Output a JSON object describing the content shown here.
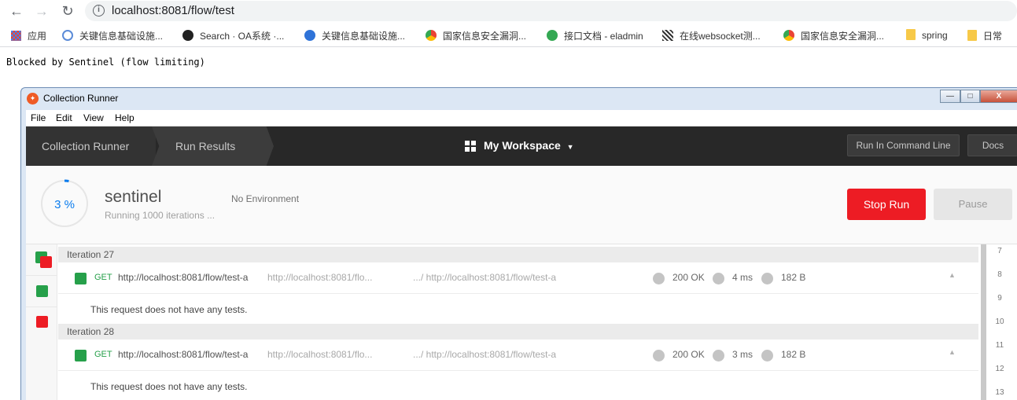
{
  "browser": {
    "url": "localhost:8081/flow/test",
    "bookmarks": [
      {
        "label": "应用",
        "color": "#4285f4"
      },
      {
        "label": "关键信息基础设施...",
        "color": "#5b8bd8"
      },
      {
        "label": "Search · OA系统 ·...",
        "color": "#222222"
      },
      {
        "label": "关键信息基础设施...",
        "color": "#2f73d8"
      },
      {
        "label": "国家信息安全漏洞...",
        "color": "#e8a33a"
      },
      {
        "label": "接口文档 - eladmin",
        "color": "#34a853"
      },
      {
        "label": "在线websocket测...",
        "color": "#555555"
      },
      {
        "label": "国家信息安全漏洞...",
        "color": "#e8a33a"
      },
      {
        "label": "spring",
        "color": "#f7c948"
      },
      {
        "label": "日常",
        "color": "#f7c948"
      }
    ]
  },
  "page": {
    "message": "Blocked by Sentinel (flow limiting)"
  },
  "window": {
    "title": "Collection Runner",
    "menu": [
      "File",
      "Edit",
      "View",
      "Help"
    ],
    "header": {
      "crumb_runner": "Collection Runner",
      "crumb_results": "Run Results",
      "workspace": "My Workspace",
      "run_cli": "Run In Command Line",
      "docs": "Docs"
    },
    "run": {
      "progress_label": "3 %",
      "progress_fraction": 0.03,
      "collection": "sentinel",
      "status": "Running 1000 iterations ...",
      "environment": "No Environment",
      "stop": "Stop Run",
      "pause": "Pause"
    },
    "iterations": [
      {
        "label": "Iteration 27",
        "method": "GET",
        "url": "http://localhost:8081/flow/test-a",
        "url_short": "http://localhost:8081/flo...",
        "url_tail": ".../ http://localhost:8081/flow/test-a",
        "status": "200 OK",
        "time": "4 ms",
        "size": "182 B",
        "tests": "This request does not have any tests."
      },
      {
        "label": "Iteration 28",
        "method": "GET",
        "url": "http://localhost:8081/flow/test-a",
        "url_short": "http://localhost:8081/flo...",
        "url_tail": ".../ http://localhost:8081/flow/test-a",
        "status": "200 OK",
        "time": "3 ms",
        "size": "182 B",
        "tests": "This request does not have any tests."
      }
    ],
    "line_numbers": [
      "7",
      "8",
      "9",
      "10",
      "11",
      "12",
      "13"
    ]
  }
}
